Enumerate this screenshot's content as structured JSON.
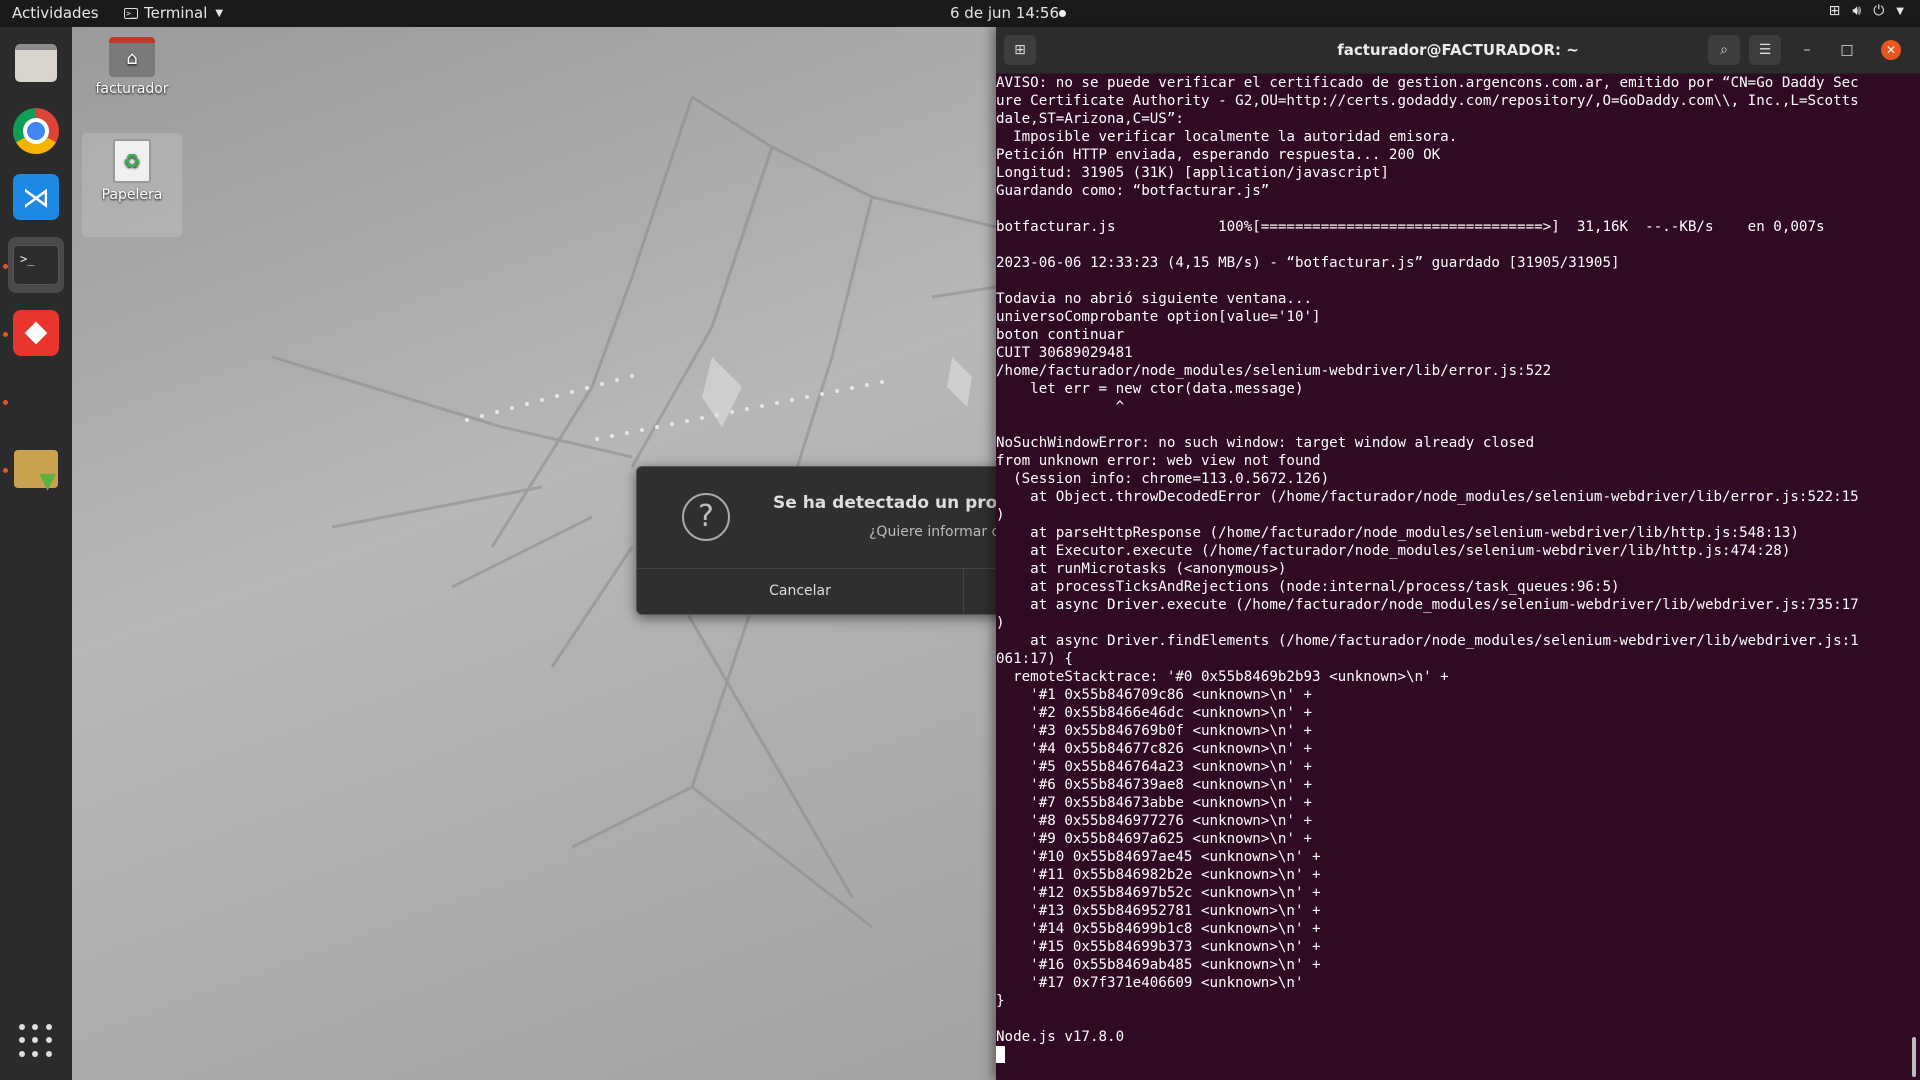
{
  "topbar": {
    "activities": "Actividades",
    "app_menu": "Terminal",
    "clock": "6 de jun  14:56"
  },
  "dock": {
    "items": [
      "files-icon",
      "chrome-icon",
      "vscode-icon",
      "terminal-icon",
      "anydesk-icon",
      "package-icon",
      "show-apps-icon"
    ]
  },
  "desktop": {
    "icons": [
      {
        "label": "facturador"
      },
      {
        "label": "Papelera"
      }
    ],
    "dialog": {
      "title": "Se ha detectado un problema",
      "subtitle": "¿Quiere informar del problema?",
      "cancel": "Cancelar"
    }
  },
  "terminal": {
    "title": "facturador@FACTURADOR: ~",
    "lines": [
      "AVISO: no se puede verificar el certificado de gestion.argencons.com.ar, emitido por “CN=Go Daddy Sec",
      "ure Certificate Authority - G2,OU=http://certs.godaddy.com/repository/,O=GoDaddy.com\\\\, Inc.,L=Scotts",
      "dale,ST=Arizona,C=US”:",
      "  Imposible verificar localmente la autoridad emisora.",
      "Petición HTTP enviada, esperando respuesta... 200 OK",
      "Longitud: 31905 (31K) [application/javascript]",
      "Guardando como: “botfacturar.js”",
      "",
      "botfacturar.js            100%[=================================>]  31,16K  --.-KB/s    en 0,007s",
      "",
      "2023-06-06 12:33:23 (4,15 MB/s) - “botfacturar.js” guardado [31905/31905]",
      "",
      "Todavia no abrió siguiente ventana...",
      "universoComprobante option[value='10']",
      "boton continuar",
      "CUIT 30689029481",
      "/home/facturador/node_modules/selenium-webdriver/lib/error.js:522",
      "    let err = new ctor(data.message)",
      "              ^",
      "",
      "NoSuchWindowError: no such window: target window already closed",
      "from unknown error: web view not found",
      "  (Session info: chrome=113.0.5672.126)",
      "    at Object.throwDecodedError (/home/facturador/node_modules/selenium-webdriver/lib/error.js:522:15",
      ")",
      "    at parseHttpResponse (/home/facturador/node_modules/selenium-webdriver/lib/http.js:548:13)",
      "    at Executor.execute (/home/facturador/node_modules/selenium-webdriver/lib/http.js:474:28)",
      "    at runMicrotasks (<anonymous>)",
      "    at processTicksAndRejections (node:internal/process/task_queues:96:5)",
      "    at async Driver.execute (/home/facturador/node_modules/selenium-webdriver/lib/webdriver.js:735:17",
      ")",
      "    at async Driver.findElements (/home/facturador/node_modules/selenium-webdriver/lib/webdriver.js:1",
      "061:17) {",
      "  remoteStacktrace: '#0 0x55b8469b2b93 <unknown>\\n' +",
      "    '#1 0x55b846709c86 <unknown>\\n' +",
      "    '#2 0x55b8466e46dc <unknown>\\n' +",
      "    '#3 0x55b846769b0f <unknown>\\n' +",
      "    '#4 0x55b84677c826 <unknown>\\n' +",
      "    '#5 0x55b846764a23 <unknown>\\n' +",
      "    '#6 0x55b846739ae8 <unknown>\\n' +",
      "    '#7 0x55b84673abbe <unknown>\\n' +",
      "    '#8 0x55b846977276 <unknown>\\n' +",
      "    '#9 0x55b84697a625 <unknown>\\n' +",
      "    '#10 0x55b84697ae45 <unknown>\\n' +",
      "    '#11 0x55b846982b2e <unknown>\\n' +",
      "    '#12 0x55b84697b52c <unknown>\\n' +",
      "    '#13 0x55b846952781 <unknown>\\n' +",
      "    '#14 0x55b84699b1c8 <unknown>\\n' +",
      "    '#15 0x55b84699b373 <unknown>\\n' +",
      "    '#16 0x55b8469ab485 <unknown>\\n' +",
      "    '#17 0x7f371e406609 <unknown>\\n'",
      "}",
      "",
      "Node.js v17.8.0"
    ]
  }
}
